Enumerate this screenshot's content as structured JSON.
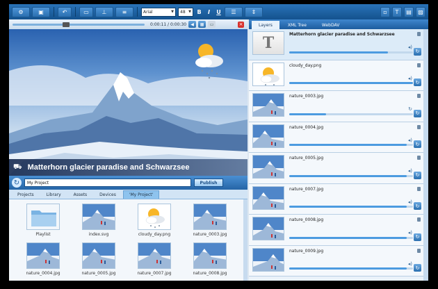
{
  "toolbar": {
    "font_name": "Arial",
    "font_size": "48",
    "bold": "B",
    "italic": "I",
    "underline": "U"
  },
  "player": {
    "time": "0:00:11 / 0:00:30"
  },
  "preview": {
    "caption": "Matterhorn glacier paradise and Schwarzsee"
  },
  "project": {
    "name": "My Project",
    "publish_label": "Publish"
  },
  "library_tabs": [
    "Projects",
    "Library",
    "Assets",
    "Devices",
    "'My Project'"
  ],
  "assets": [
    {
      "label": "Playlist",
      "kind": "folder"
    },
    {
      "label": "index.svg",
      "kind": "photo"
    },
    {
      "label": "cloudy_day.png",
      "kind": "weather"
    },
    {
      "label": "nature_0003.jpg",
      "kind": "photo"
    },
    {
      "label": "nature_0004.jpg",
      "kind": "photo"
    },
    {
      "label": "nature_0005.jpg",
      "kind": "photo"
    },
    {
      "label": "nature_0007.jpg",
      "kind": "photo"
    },
    {
      "label": "nature_0008.jpg",
      "kind": "photo"
    }
  ],
  "right_tabs": [
    "Layers",
    "XML Tree",
    "WebDAV"
  ],
  "layers": [
    {
      "name": "Matterhorn glacier paradise and Schwarzsee",
      "kind": "text",
      "progress": 0.8
    },
    {
      "name": "cloudy_day.png",
      "kind": "weather",
      "progress": 1.0
    },
    {
      "name": "nature_0003.jpg",
      "kind": "photo",
      "progress": 0.3
    },
    {
      "name": "nature_0004.jpg",
      "kind": "photo",
      "progress": 0.95
    },
    {
      "name": "nature_0005.jpg",
      "kind": "photo",
      "progress": 0.95
    },
    {
      "name": "nature_0007.jpg",
      "kind": "photo",
      "progress": 0.95
    },
    {
      "name": "nature_0008.jpg",
      "kind": "photo",
      "progress": 0.95
    },
    {
      "name": "nature_0009.jpg",
      "kind": "photo",
      "progress": 0.95
    }
  ],
  "colors": {
    "accent": "#2a6fb0",
    "toolbar": "#1c5c9e",
    "progress": "#4c9be0"
  }
}
